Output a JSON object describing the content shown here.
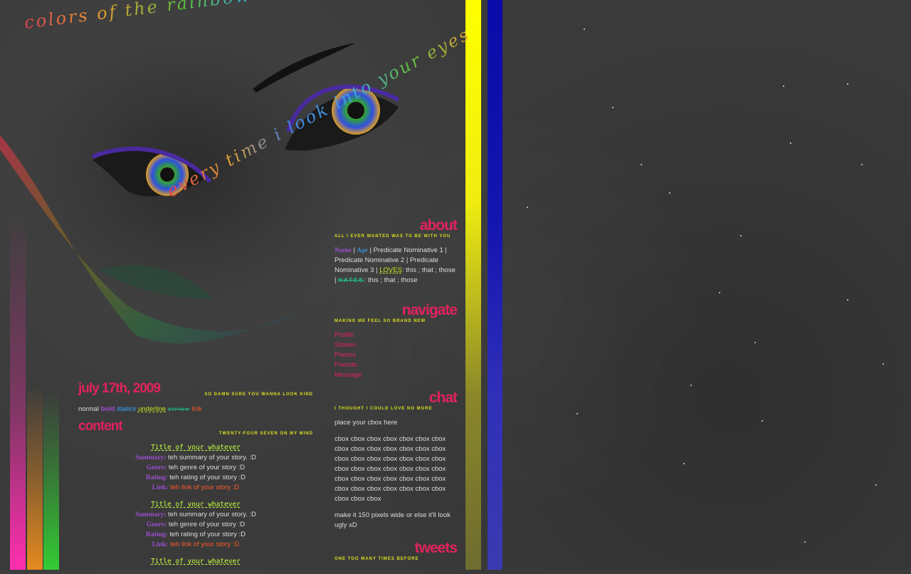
{
  "header": {
    "tagline_top": "colors of the rainbow shine so bright",
    "tagline_eyes": "every time i look into your eyes"
  },
  "sidebar": {
    "about": {
      "title": "about",
      "subtitle": "ALL I EVER WANTED WAS TO BE WITH YOU",
      "name": "Name",
      "age": "Age",
      "sep1": " | Predicate Nominative 1 | Predicate Nominative 2 | Predicate Nominative 3 | ",
      "loves": "LOVES",
      "loves_text": ": this ; that ; those |",
      "hates": "HATES",
      "hates_text": ": this ; that ; those"
    },
    "navigate": {
      "title": "navigate",
      "subtitle": "MAKING ME FEEL SO BRAND NEW",
      "items": [
        "Profile",
        "Stories",
        "Poems",
        "Friends",
        "Message"
      ]
    },
    "chat": {
      "title": "chat",
      "subtitle": "I THOUGHT I COULD LOVE NO MORE",
      "placeholder": "place your cbox here",
      "cbox": "cbox cbox cbox cbox cbox cbox cbox cbox cbox cbox cbox cbox cbox cbox cbox cbox cbox cbox cbox cbox cbox cbox cbox cbox cbox cbox cbox cbox cbox cbox cbox cbox cbox cbox cbox cbox cbox cbox cbox cbox cbox cbox cbox cbox cbox",
      "note": "make it 150 pixels wide or else it'll look ugly xD"
    },
    "tweets": {
      "title": "tweets",
      "subtitle": "ONE TOO MANY TIMES BEFORE"
    }
  },
  "main": {
    "date": "july 17th, 2009",
    "date_sub": "SO DAMN SURE YOU WANNA LOOK KIND",
    "format": {
      "normal": "normal",
      "bold": "bold",
      "italics": "italics",
      "underline": "underline",
      "strike": "strike",
      "link": "link"
    },
    "content_title": "content",
    "content_sub": "TWENTY-FOUR SEVEN ON MY MIND",
    "stories": [
      {
        "title": "Title of your whatever",
        "summary_label": "Summary:",
        "summary": "teh summary of your story. :D",
        "genre_label": "Genre:",
        "genre": "teh genre of your story :D",
        "rating_label": "Rating:",
        "rating": "teh rating of your story :D",
        "link_label": "Link:",
        "link": "teh link of your story :D"
      },
      {
        "title": "Title of your whatever",
        "summary_label": "Summary:",
        "summary": "teh summary of your story. :D",
        "genre_label": "Genre:",
        "genre": "teh genre of your story :D",
        "rating_label": "Rating:",
        "rating": "teh rating of your story :D",
        "link_label": "Link:",
        "link": "teh link of your story :D"
      },
      {
        "title": "Title of your whatever"
      }
    ]
  },
  "colors": {
    "accent": "#e2225e",
    "subtitle": "#d8e020",
    "yellow_bar": "#ffff00",
    "blue_bar": "#0a0aa8"
  }
}
